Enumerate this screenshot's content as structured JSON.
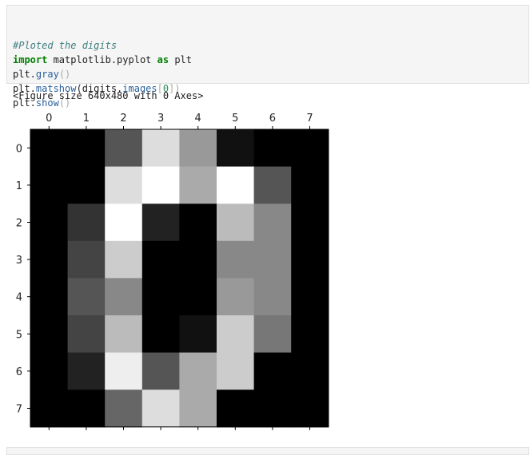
{
  "code": {
    "lines": [
      [
        {
          "t": "#Ploted the digits",
          "c": "comment"
        }
      ],
      [
        {
          "t": "import",
          "c": "keyword"
        },
        {
          "t": " matplotlib.pyplot ",
          "c": "text"
        },
        {
          "t": "as",
          "c": "keyword"
        },
        {
          "t": " plt",
          "c": "text"
        }
      ],
      [
        {
          "t": "plt.",
          "c": "text"
        },
        {
          "t": "gray",
          "c": "attr"
        },
        {
          "t": "()",
          "c": "paren"
        }
      ],
      [
        {
          "t": "plt.",
          "c": "text"
        },
        {
          "t": "matshow",
          "c": "attr"
        },
        {
          "t": "(digits.",
          "c": "text"
        },
        {
          "t": "images",
          "c": "attr"
        },
        {
          "t": "[",
          "c": "paren"
        },
        {
          "t": "0",
          "c": "num"
        },
        {
          "t": "])",
          "c": "paren"
        }
      ],
      [
        {
          "t": "plt.",
          "c": "text"
        },
        {
          "t": "show",
          "c": "attr"
        },
        {
          "t": "()",
          "c": "paren"
        }
      ]
    ]
  },
  "output": {
    "figure_repr": "<Figure size 640x480 with 0 Axes>"
  },
  "chart_data": {
    "type": "heatmap",
    "colormap": "gray",
    "x_ticks": [
      "0",
      "1",
      "2",
      "3",
      "4",
      "5",
      "6",
      "7"
    ],
    "y_ticks": [
      "0",
      "1",
      "2",
      "3",
      "4",
      "5",
      "6",
      "7"
    ],
    "xlim": [
      -0.5,
      7.5
    ],
    "ylim": [
      7.5,
      -0.5
    ],
    "vmin": 0,
    "vmax": 15,
    "values": [
      [
        0,
        0,
        5,
        13,
        9,
        1,
        0,
        0
      ],
      [
        0,
        0,
        13,
        15,
        10,
        15,
        5,
        0
      ],
      [
        0,
        3,
        15,
        2,
        0,
        11,
        8,
        0
      ],
      [
        0,
        4,
        12,
        0,
        0,
        8,
        8,
        0
      ],
      [
        0,
        5,
        8,
        0,
        0,
        9,
        8,
        0
      ],
      [
        0,
        4,
        11,
        0,
        1,
        12,
        7,
        0
      ],
      [
        0,
        2,
        14,
        5,
        10,
        12,
        0,
        0
      ],
      [
        0,
        0,
        6,
        13,
        10,
        0,
        0,
        0
      ]
    ]
  }
}
